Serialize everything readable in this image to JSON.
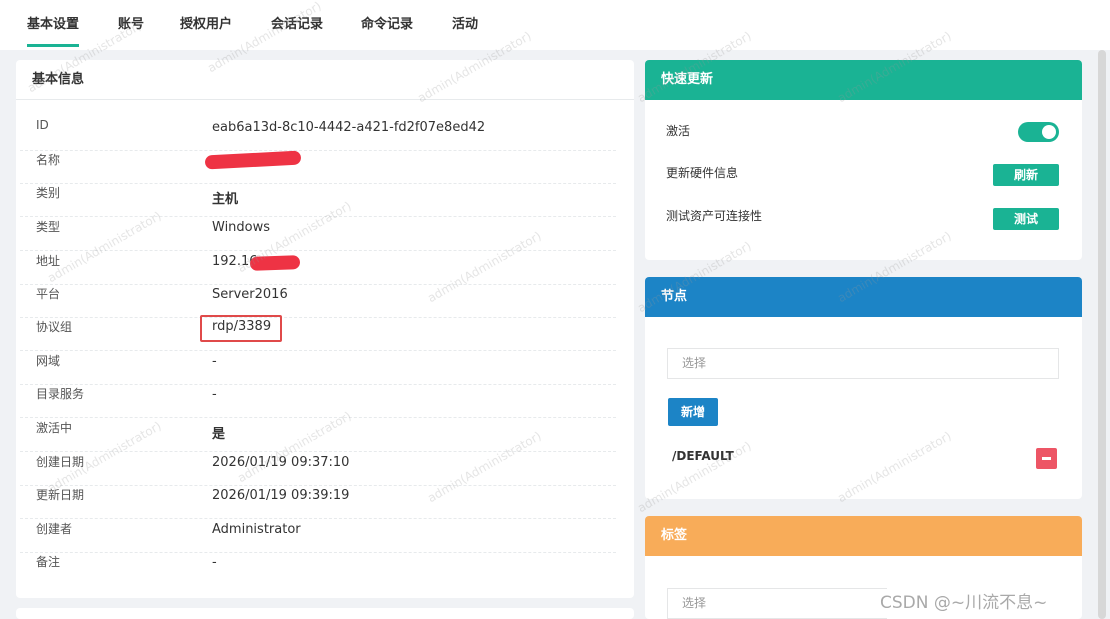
{
  "tabs": [
    {
      "label": "基本设置",
      "active": true
    },
    {
      "label": "账号"
    },
    {
      "label": "授权用户"
    },
    {
      "label": "会话记录"
    },
    {
      "label": "命令记录"
    },
    {
      "label": "活动"
    }
  ],
  "basic_info": {
    "title": "基本信息",
    "rows": [
      {
        "label": "ID",
        "value": "eab6a13d-8c10-4442-a421-fd2f07e8ed42"
      },
      {
        "label": "名称",
        "value": ""
      },
      {
        "label": "类别",
        "value": "主机"
      },
      {
        "label": "类型",
        "value": "Windows"
      },
      {
        "label": "地址",
        "value": "192.16"
      },
      {
        "label": "平台",
        "value": "Server2016"
      },
      {
        "label": "协议组",
        "value": "rdp/3389"
      },
      {
        "label": "网域",
        "value": "-"
      },
      {
        "label": "目录服务",
        "value": "-"
      },
      {
        "label": "激活中",
        "value": "是"
      },
      {
        "label": "创建日期",
        "value": "2026/01/19 09:37:10"
      },
      {
        "label": "更新日期",
        "value": "2026/01/19 09:39:19"
      },
      {
        "label": "创建者",
        "value": "Administrator"
      },
      {
        "label": "备注",
        "value": "-"
      }
    ]
  },
  "quick_update": {
    "title": "快速更新",
    "header_color": "#1ab394",
    "activate_label": "激活",
    "activate_on": true,
    "hardware_label": "更新硬件信息",
    "hardware_button": "刷新",
    "connectivity_label": "测试资产可连接性",
    "connectivity_button": "测试"
  },
  "nodes": {
    "title": "节点",
    "header_color": "#1c84c6",
    "select_placeholder": "选择",
    "add_button": "新增",
    "items": [
      "/DEFAULT"
    ]
  },
  "tags": {
    "title": "标签",
    "header_color": "#f8ac59",
    "select_placeholder": "选择"
  },
  "watermark_text": "admin(Administrator)",
  "csdn_watermark": "CSDN @~川流不息~"
}
